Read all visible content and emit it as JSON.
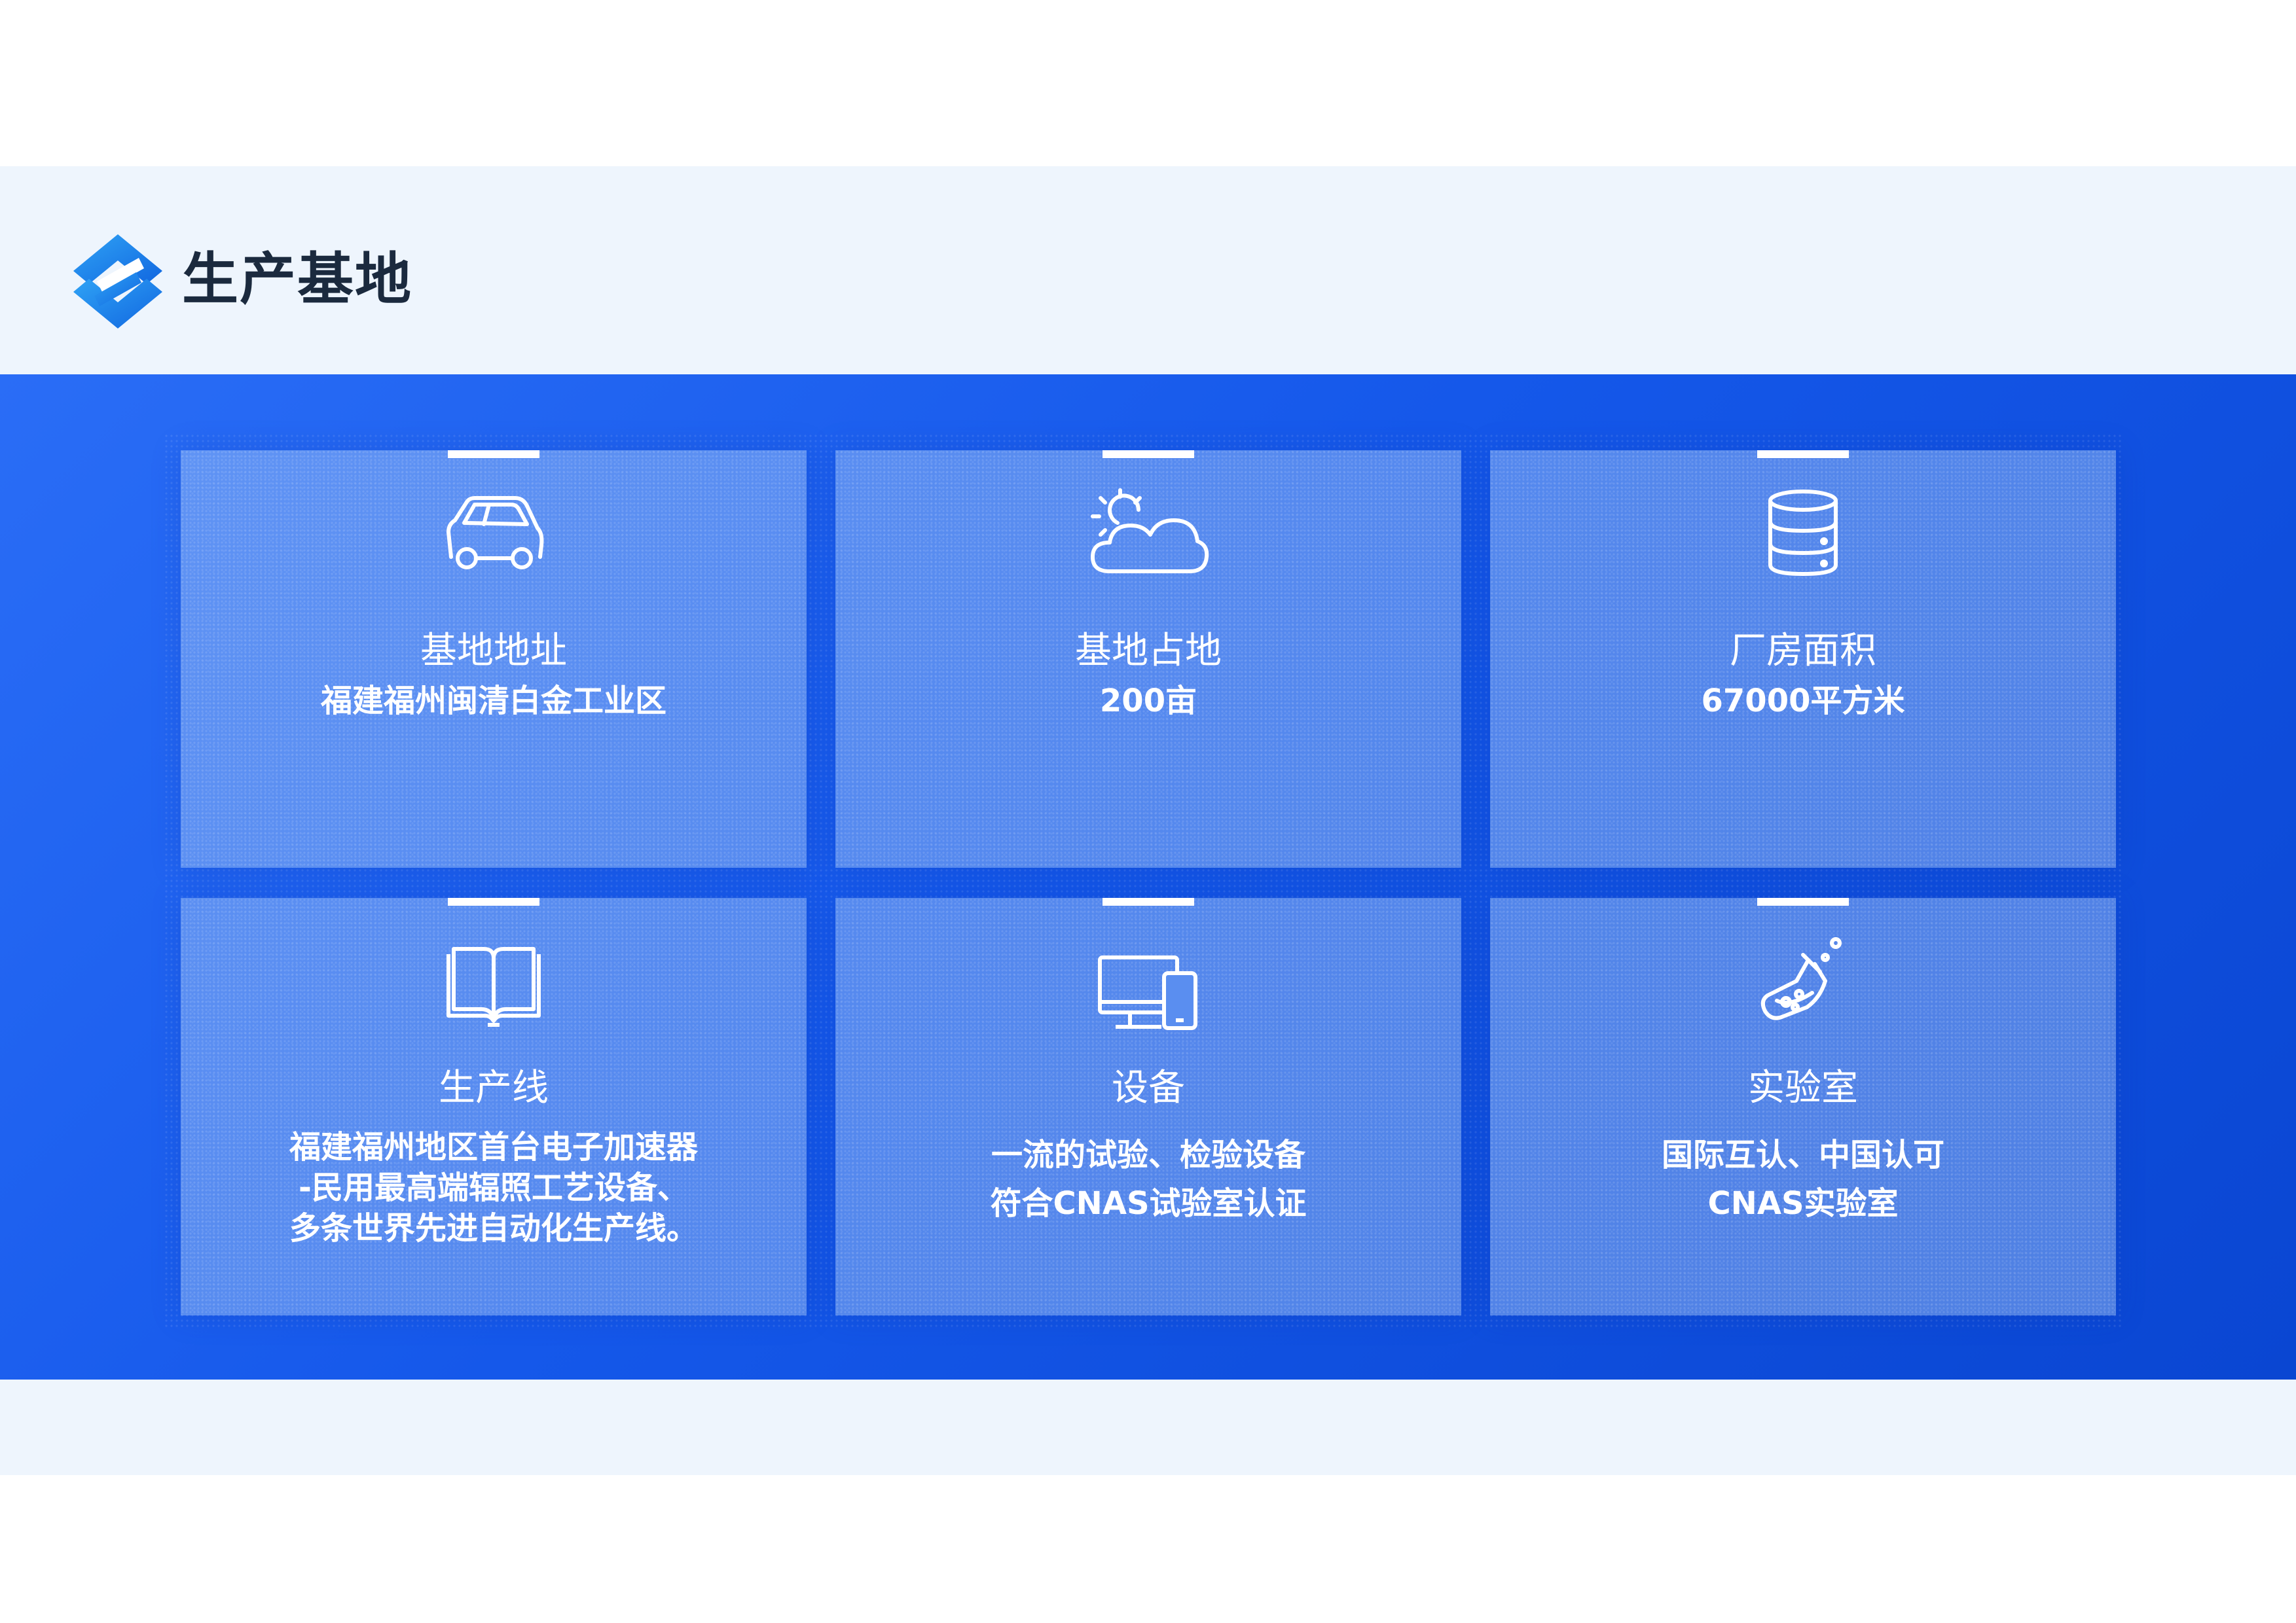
{
  "header": {
    "title": "生产基地",
    "logo_icon": "brand-logo-icon"
  },
  "colors": {
    "accent": "#1558ea",
    "title": "#1b2a3e",
    "band": "#eef5fd"
  },
  "cards": [
    {
      "icon": "car-icon",
      "label": "基地地址",
      "value": [
        "福建福州闽清白金工业区"
      ]
    },
    {
      "icon": "sun-cloud-icon",
      "label": "基地占地",
      "value": [
        "200亩"
      ]
    },
    {
      "icon": "database-icon",
      "label": "厂房面积",
      "value": [
        "67000平方米"
      ]
    },
    {
      "icon": "book-icon",
      "label": "生产线",
      "value": [
        "福建福州地区首台电子加速器",
        "-民用最高端辐照工艺设备、",
        "多条世界先进自动化生产线。"
      ]
    },
    {
      "icon": "computer-icon",
      "label": "设备",
      "value": [
        "一流的试验、检验设备",
        "符合CNAS试验室认证"
      ]
    },
    {
      "icon": "flask-icon",
      "label": "实验室",
      "value": [
        "国际互认、中国认可",
        "CNAS实验室"
      ]
    }
  ]
}
